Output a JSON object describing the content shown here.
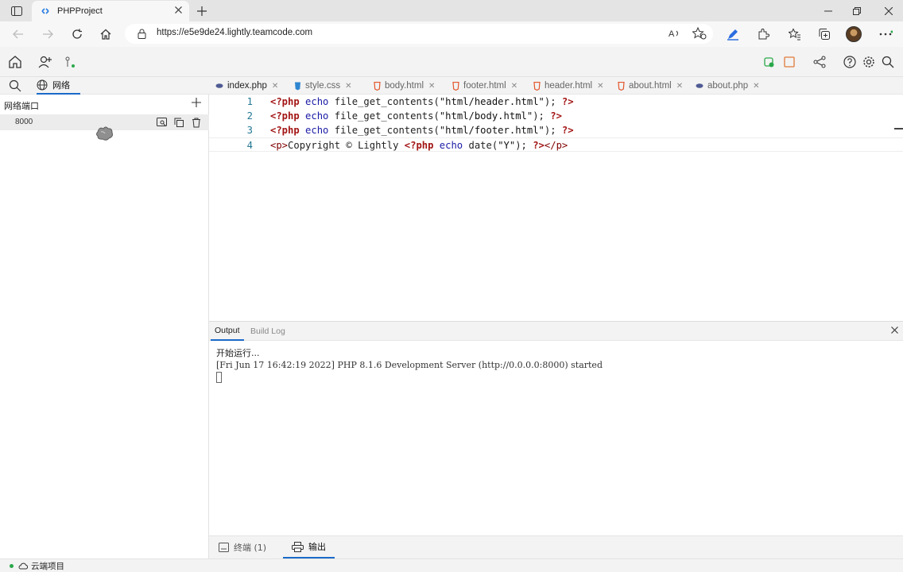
{
  "browser": {
    "tab_title": "PHPProject",
    "url": "https://e5e9de24.lightly.teamcode.com"
  },
  "sidebar": {
    "tab_label": "网络",
    "section_title": "网络端口",
    "ports": [
      {
        "port": "8000"
      }
    ]
  },
  "editor": {
    "tabs": [
      {
        "label": "index.php",
        "kind": "php",
        "active": true
      },
      {
        "label": "style.css",
        "kind": "css",
        "active": false
      },
      {
        "label": "body.html",
        "kind": "html",
        "active": false
      },
      {
        "label": "footer.html",
        "kind": "html",
        "active": false
      },
      {
        "label": "header.html",
        "kind": "html",
        "active": false
      },
      {
        "label": "about.html",
        "kind": "html",
        "active": false
      },
      {
        "label": "about.php",
        "kind": "php",
        "active": false
      }
    ],
    "lines": [
      {
        "n": "1",
        "text": "<?php echo file_get_contents(\"html/header.html\"); ?>"
      },
      {
        "n": "2",
        "text": "<?php echo file_get_contents(\"html/body.html\"); ?>"
      },
      {
        "n": "3",
        "text": "<?php echo file_get_contents(\"html/footer.html\"); ?>"
      },
      {
        "n": "4",
        "text": "<p>Copyright © Lightly <?php echo date(\"Y\"); ?></p>"
      }
    ]
  },
  "output": {
    "tabs": [
      "Output",
      "Build Log"
    ],
    "lines": [
      "开始运行...",
      "[Fri Jun 17 16:42:19 2022] PHP 8.1.6 Development Server (http://0.0.0.0:8000) started"
    ]
  },
  "bottom_tabs": {
    "terminal": "终端 (1)",
    "output": "输出"
  },
  "status": {
    "cloud_project": "云端项目"
  },
  "colors": {
    "accent": "#1b6ac9",
    "php_tag": "#a31515",
    "keyword": "#1a1aa6",
    "line_number": "#237893"
  }
}
